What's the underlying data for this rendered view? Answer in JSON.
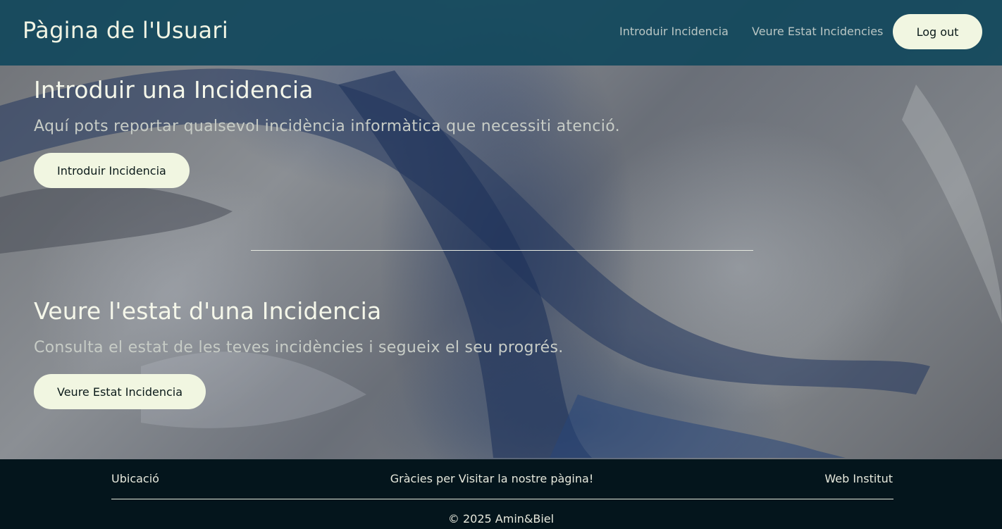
{
  "header": {
    "title": "Pàgina de l'Usuari",
    "nav": [
      "Introduir Incidencia",
      "Veure Estat Incidencies"
    ],
    "logout_label": "Log out"
  },
  "sections": [
    {
      "heading": "Introduir una Incidencia",
      "description": "Aquí pots reportar qualsevol incidència informàtica que necessiti atenció.",
      "button_label": "Introduir Incidencia"
    },
    {
      "heading": "Veure l'estat d'una Incidencia",
      "description": "Consulta el estat de les teves incidències i segueix el seu progrés.",
      "button_label": "Veure Estat Incidencia"
    }
  ],
  "footer": {
    "left_link": "Ubicació",
    "thanks": "Gràcies per Visitar la nostre pàgina!",
    "right_link": "Web Institut",
    "copyright": "© 2025 Amin&Biel"
  },
  "colors": {
    "header_bg": "#12485c",
    "button_bg": "#f1f6e1",
    "footer_bg": "#04151c"
  }
}
